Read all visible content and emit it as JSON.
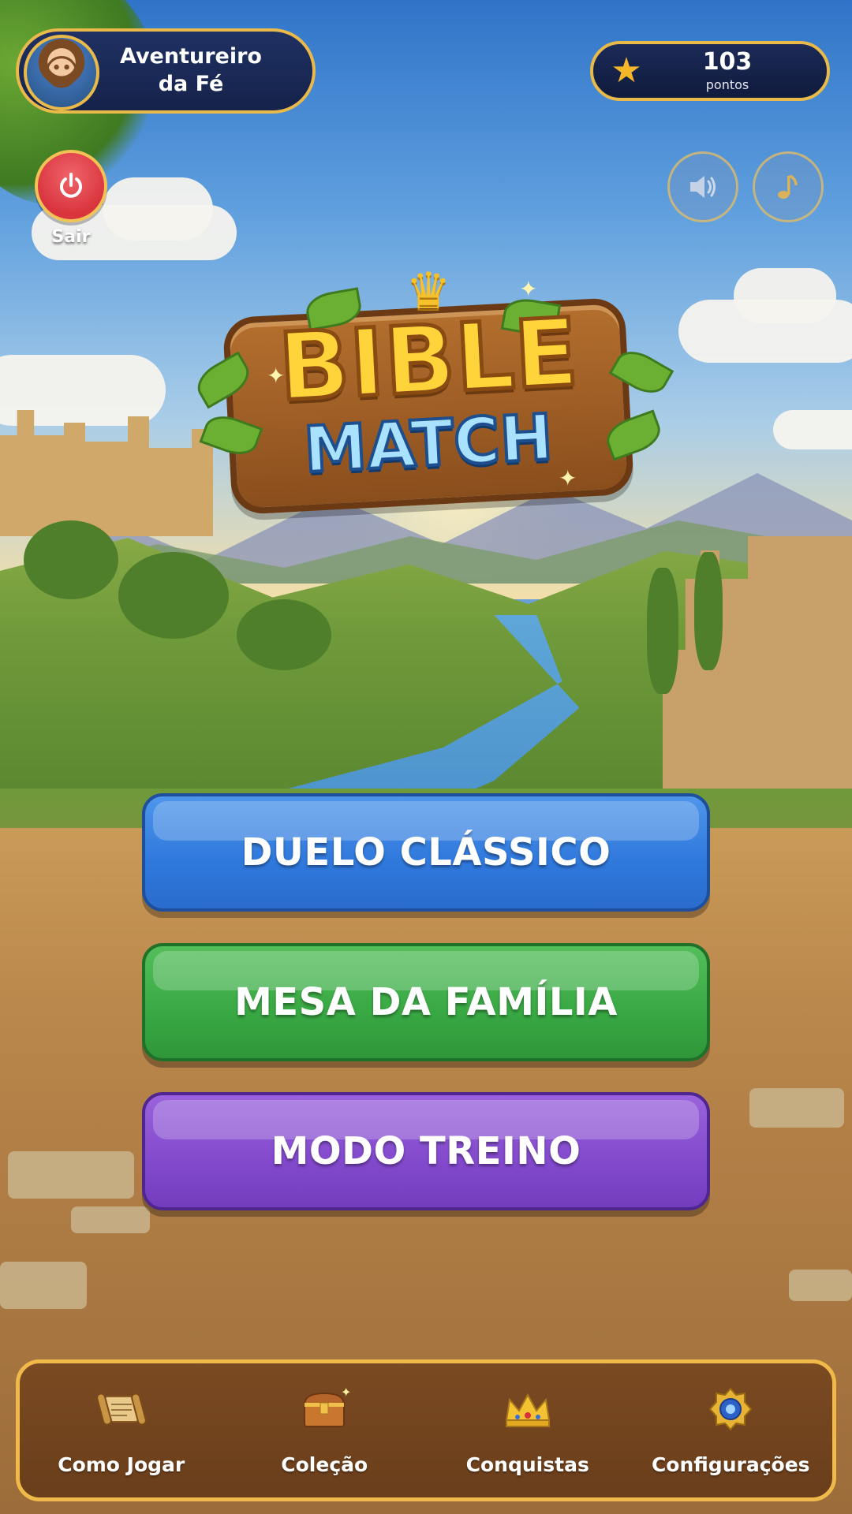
{
  "profile": {
    "name": "Aventureiro da Fé",
    "avatar_icon": "adventurer-avatar"
  },
  "score": {
    "value": "103",
    "label": "pontos",
    "icon": "star-icon"
  },
  "exit": {
    "label": "Sair",
    "icon": "power-icon"
  },
  "audio": {
    "sound_icon": "speaker-icon",
    "music_icon": "music-note-icon"
  },
  "logo": {
    "title": "BIBLE",
    "subtitle": "MATCH"
  },
  "modes": [
    {
      "label": "DUELO CLÁSSICO",
      "color": "#2f78dc"
    },
    {
      "label": "MESA DA FAMÍLIA",
      "color": "#38a843"
    },
    {
      "label": "MODO TREINO",
      "color": "#8249cc"
    }
  ],
  "nav": [
    {
      "label": "Como Jogar",
      "icon": "scroll-icon"
    },
    {
      "label": "Coleção",
      "icon": "treasure-chest-icon"
    },
    {
      "label": "Conquistas",
      "icon": "crown-icon"
    },
    {
      "label": "Configurações",
      "icon": "gear-icon"
    }
  ],
  "colors": {
    "accent_gold": "#e9b94a",
    "nav_brown": "#7a4a22",
    "top_bar_navy": "#1f3163"
  }
}
